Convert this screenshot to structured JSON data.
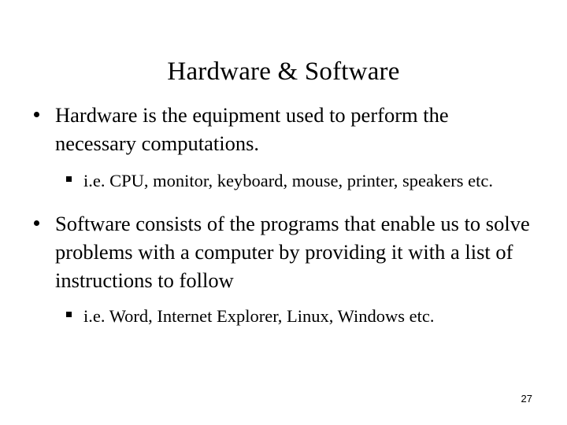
{
  "slide": {
    "title": "Hardware & Software",
    "page_number": "27",
    "background_color": "#ffffff",
    "text_color": "#000000",
    "bullet_level1_marker": "bullet-dot",
    "bullet_level2_marker": "bullet-square",
    "content": [
      {
        "level": 1,
        "text": "Hardware is the equipment used to perform the necessary computations."
      },
      {
        "level": 2,
        "text": "i.e. CPU, monitor, keyboard, mouse, printer, speakers etc."
      },
      {
        "level": 1,
        "text": "Software consists of the programs that enable us to solve problems with a computer by providing it with a list of instructions to follow"
      },
      {
        "level": 2,
        "text": "i.e. Word, Internet Explorer, Linux, Windows etc."
      }
    ]
  }
}
